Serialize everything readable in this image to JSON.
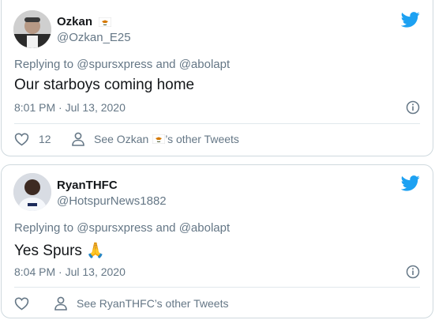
{
  "tweets": [
    {
      "name": "Ozkan",
      "handle": "@Ozkan_E25",
      "replying_prefix": "Replying to",
      "mention1": "@spursxpress",
      "and_text": "and",
      "mention2": "@abolapt",
      "text": "Our starboys coming home",
      "timestamp": "8:01 PM · Jul 13, 2020",
      "like_count": "12",
      "see_prefix": "See Ozkan",
      "see_suffix": "’s other Tweets"
    },
    {
      "name": "RyanTHFC",
      "handle": "@HotspurNews1882",
      "replying_prefix": "Replying to",
      "mention1": "@spursxpress",
      "and_text": "and",
      "mention2": "@abolapt",
      "text": "Yes Spurs",
      "emoji": "🙏",
      "timestamp": "8:04 PM · Jul 13, 2020",
      "see_text": "See RyanTHFC’s other Tweets"
    }
  ],
  "colors": {
    "twitter_blue": "#1da1f2",
    "text_primary": "#14171a",
    "text_secondary": "#657786",
    "border": "#cfd9de"
  },
  "icons": {
    "logo": "twitter-bird-icon",
    "info": "info-icon",
    "like": "heart-icon",
    "profile": "person-icon",
    "flag": "cyprus-flag-icon"
  }
}
